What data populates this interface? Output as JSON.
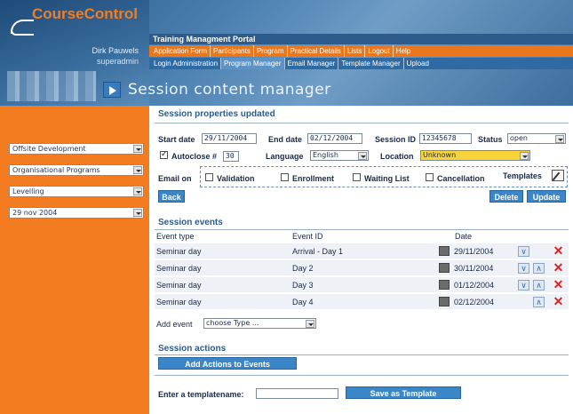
{
  "app": {
    "logo_text": "CourseControl",
    "portal_title": "Training Managment Portal"
  },
  "user": {
    "name": "Dirk Pauwels",
    "role": "superadmin"
  },
  "nav_primary": [
    "Application Form",
    "Participants",
    "Program",
    "Practical Details",
    "Lists",
    "Logout",
    "Help"
  ],
  "nav_secondary": [
    "Login Administration",
    "Program Manager",
    "Email Manager",
    "Template Manager",
    "Upload"
  ],
  "nav_secondary_active": "Program Manager",
  "page_title": "Session content manager",
  "sidebar": {
    "selects": [
      "Offsite Development",
      "Organisational Programs",
      "Levelling",
      "29 nov 2004"
    ]
  },
  "properties": {
    "heading": "Session properties updated",
    "start_date_label": "Start date",
    "start_date": "29/11/2004",
    "end_date_label": "End date",
    "end_date": "02/12/2004",
    "session_id_label": "Session ID",
    "session_id": "12345678",
    "status_label": "Status",
    "status": "open",
    "autoclose_label": "Autoclose #",
    "autoclose_value": "30",
    "language_label": "Language",
    "language": "English",
    "location_label": "Location",
    "location": "Unknown",
    "email_on_label": "Email on",
    "email_options": [
      "Validation",
      "Enrollment",
      "Waiting List",
      "Cancellation"
    ],
    "templates_label": "Templates",
    "back_label": "Back",
    "delete_label": "Delete",
    "update_label": "Update"
  },
  "events": {
    "heading": "Session events",
    "col_type": "Event type",
    "col_id": "Event ID",
    "col_date": "Date",
    "rows": [
      {
        "type": "Seminar day",
        "id": "Arrival - Day 1",
        "date": "29/11/2004"
      },
      {
        "type": "Seminar day",
        "id": "Day 2",
        "date": "30/11/2004"
      },
      {
        "type": "Seminar day",
        "id": "Day 3",
        "date": "01/12/2004"
      },
      {
        "type": "Seminar day",
        "id": "Day 4",
        "date": "02/12/2004"
      }
    ],
    "add_event_label": "Add event",
    "add_event_placeholder": "choose Type ..."
  },
  "actions": {
    "heading": "Session actions",
    "add_actions_label": "Add Actions to Events",
    "template_name_label": "Enter a templatename:",
    "save_template_label": "Save as Template"
  },
  "colors": {
    "orange": "#f47c20",
    "blue_button": "#3a86c8",
    "nav_blue": "#2f6aa2",
    "delete_red": "#e0201e"
  }
}
